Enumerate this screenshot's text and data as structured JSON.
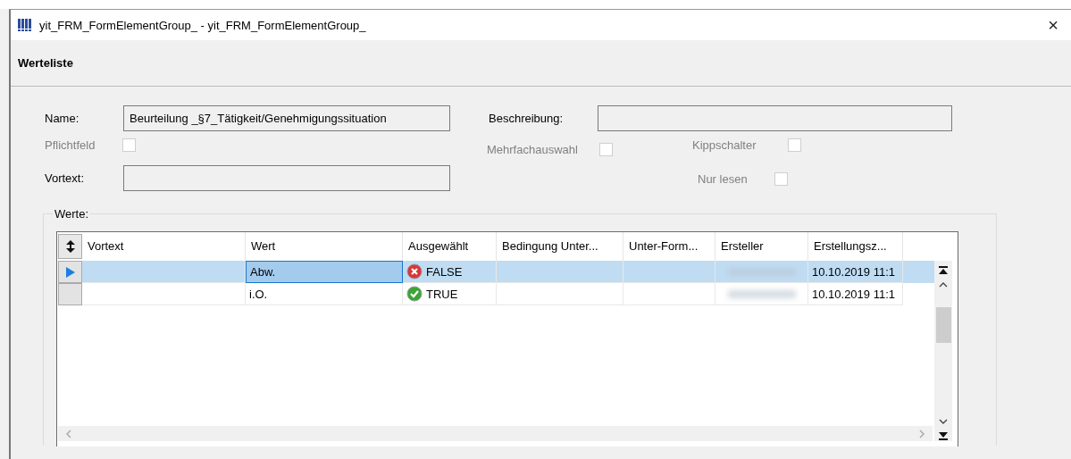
{
  "window": {
    "title": "yit_FRM_FormElementGroup_ - yit_FRM_FormElementGroup_",
    "close": "×"
  },
  "section_title": "Werteliste",
  "name_field": {
    "label": "Name:",
    "value": "Beurteilung _§7_Tätigkeit/Genehmigungssituation"
  },
  "description_field": {
    "label": "Beschreibung:"
  },
  "vortext_field": {
    "label": "Vortext:"
  },
  "checkboxes": [
    {
      "label": "Pflichtfeld",
      "checked": false,
      "disabled": true
    },
    {
      "label": "Mehrfachauswahl",
      "checked": false,
      "disabled": true
    },
    {
      "label": "Kippschalter",
      "checked": false,
      "disabled": true
    },
    {
      "label": "Nur lesen",
      "checked": false,
      "disabled": true
    }
  ],
  "values_group": {
    "legend": "Werte:",
    "columns": [
      "Vortext",
      "Wert",
      "Ausgewählt",
      "Bedingung Unter...",
      "Unter-Form...",
      "Ersteller",
      "Erstellungsz..."
    ],
    "rows": [
      {
        "selected": true,
        "value": "Abw.",
        "chosen": {
          "kind": "false",
          "text": "FALSE"
        },
        "created": "10.10.2019 11:1"
      },
      {
        "selected": false,
        "value": "i.O.",
        "chosen": {
          "kind": "true",
          "text": "TRUE"
        },
        "created": "10.10.2019 11:1"
      }
    ]
  }
}
